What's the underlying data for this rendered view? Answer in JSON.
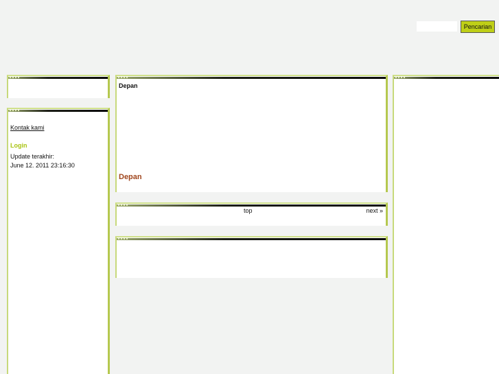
{
  "search": {
    "placeholder": "",
    "value": "",
    "button_label": "Pencarian"
  },
  "sidebar": {
    "contact_link": "Kontak kami",
    "login_link": "Login",
    "last_update_label": "Update terakhir:",
    "last_update_value": "June 12. 2011 23:16:30"
  },
  "main": {
    "breadcrumb": "Depan",
    "heading": "Depan"
  },
  "pager": {
    "top_label": "top",
    "next_label": "next »"
  },
  "colors": {
    "background": "#f2f3f2",
    "accent": "#bfcf17",
    "heading": "#a0461d",
    "login": "#a9c312"
  }
}
